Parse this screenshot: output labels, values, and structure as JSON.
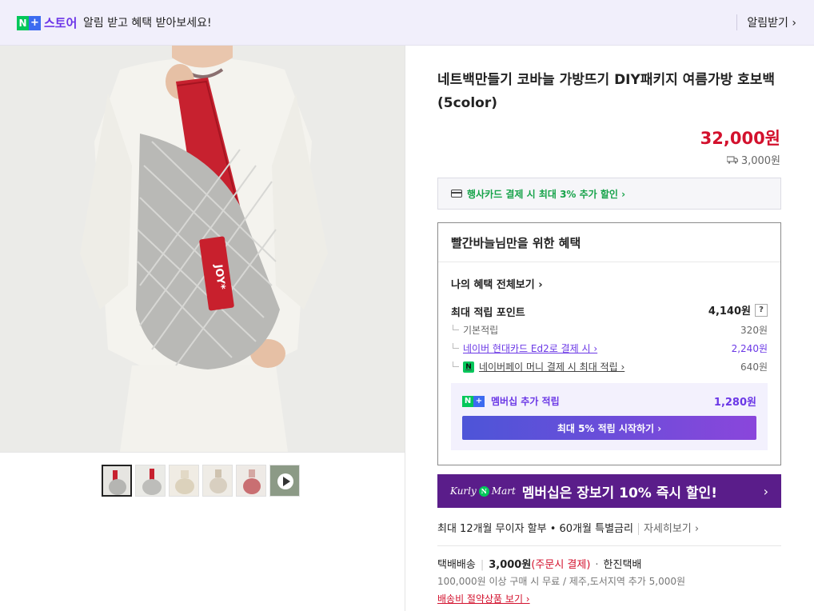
{
  "topbar": {
    "brand_n": "N",
    "brand_plus": "+",
    "brand_store": "스토어",
    "message": "알림 받고 혜택 받아보세요!",
    "alarm_label": "알림받기 ›"
  },
  "product": {
    "title": "네트백만들기 코바늘 가방뜨기 DIY패키지 여름가방 호보백 (5color)",
    "price": "32,000원",
    "shipping_fee": "3,000원",
    "tag_text": "JOY*"
  },
  "thumbnails": [
    {
      "name": "thumb-1",
      "selected": true
    },
    {
      "name": "thumb-2",
      "selected": false
    },
    {
      "name": "thumb-3",
      "selected": false
    },
    {
      "name": "thumb-4",
      "selected": false
    },
    {
      "name": "thumb-5",
      "selected": false
    },
    {
      "name": "thumb-video",
      "selected": false
    }
  ],
  "card_promo": "행사카드 결제 시 최대 3% 추가 할인 ›",
  "benefit": {
    "title": "빨간바늘님만을 위한 혜택",
    "my_benefit_link": "나의 혜택 전체보기 ›",
    "max_point_label": "최대 적립 포인트",
    "max_point_value": "4,140원",
    "help": "?",
    "rows": [
      {
        "label": "기본적립",
        "value": "320원"
      },
      {
        "label": "네이버 현대카드 Ed2로 결제 시 ›",
        "value": "2,240원"
      },
      {
        "label": "네이버페이 머니 결제 시 최대 적립 ›",
        "value": "640원"
      }
    ],
    "member_label": "멤버십 추가 적립",
    "member_value": "1,280원",
    "member_button": "최대 5% 적립 시작하기 ›"
  },
  "banner": {
    "kurly": "Kurly",
    "n": "N",
    "mart": "Mart",
    "text": "멤버십은 장보기 10% 즉시 할인!",
    "chevron": "›"
  },
  "installment": {
    "text": "최대 12개월 무이자 할부 • 60개월 특별금리",
    "more": "자세히보기 ›"
  },
  "delivery": {
    "method": "택배배송",
    "fee": "3,000원",
    "fee_note": "(주문시 결제)",
    "carrier": "한진택배",
    "line2": "100,000원 이상 구매 시 무료 / 제주,도서지역 추가 5,000원",
    "saving_link": "배송비 절약상품 보기 ›"
  },
  "colors": {
    "accent_purple": "#6b38e6",
    "price_red": "#d3112d",
    "naver_green": "#03c75a",
    "banner_purple": "#5a1d8a"
  }
}
